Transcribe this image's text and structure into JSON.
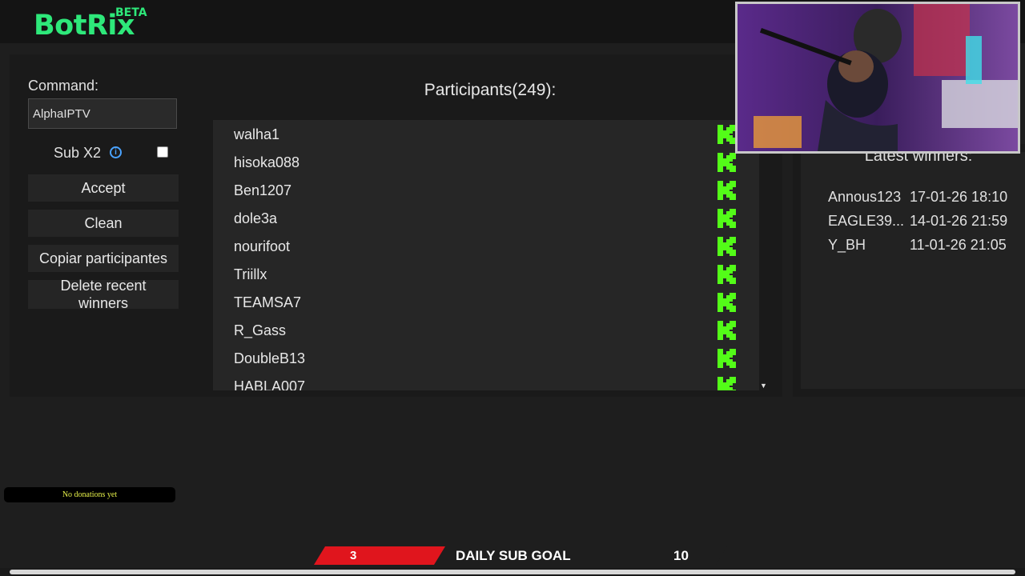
{
  "app": {
    "name": "BotRix",
    "badge": "BETA"
  },
  "form": {
    "command_label": "Command:",
    "command_value": "AlphaIPTV",
    "subx2_label": "Sub X2",
    "subx2_info_icon": "info-icon",
    "subx2_checked": false
  },
  "buttons": {
    "accept": "Accept",
    "clean": "Clean",
    "copy": "Copiar participantes",
    "delete_line1": "Delete recent",
    "delete_line2": "winners"
  },
  "participants": {
    "title": "Participants(249):",
    "platform_icon": "kick-icon",
    "names": [
      "walha1",
      "hisoka088",
      "Ben1207",
      "dole3a",
      "nourifoot",
      "Triillx",
      "TEAMSA7",
      "R_Gass",
      "DoubleB13",
      "HABLA007"
    ]
  },
  "winners": {
    "title": "Latest winners:",
    "rows": [
      {
        "name": "Annous123",
        "date": "17-01-26 18:10"
      },
      {
        "name": "EAGLE39...",
        "date": "14-01-26 21:59"
      },
      {
        "name": "Y_BH",
        "date": "11-01-26 21:05"
      }
    ]
  },
  "overlay": {
    "donations": "No donations yet",
    "sub_goal": {
      "current": "3",
      "label": "DAILY SUB GOAL",
      "target": "10"
    }
  },
  "colors": {
    "brand": "#2ee87a",
    "kick": "#53fc18",
    "goal_red": "#e0151d",
    "info_blue": "#4aa3ff"
  }
}
